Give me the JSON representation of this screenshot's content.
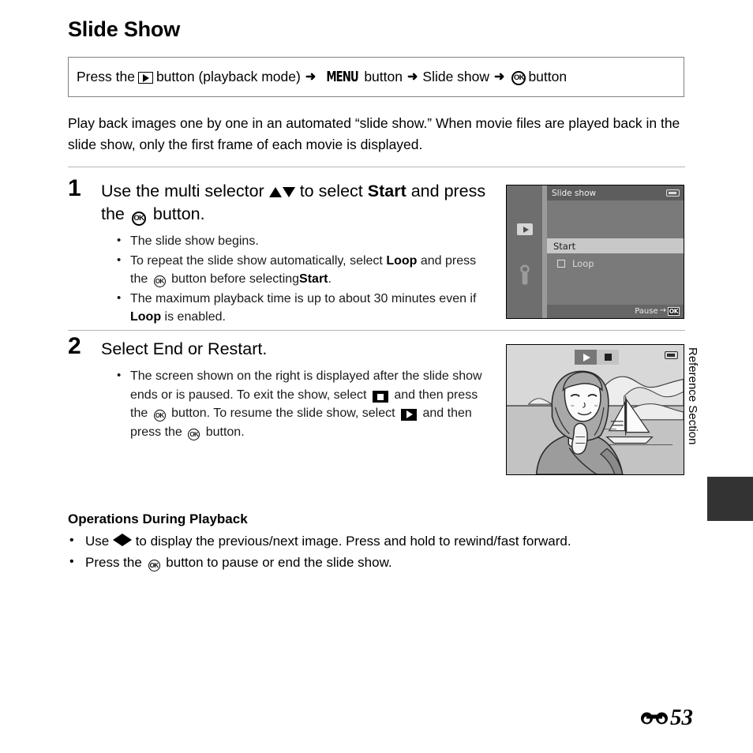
{
  "page": {
    "title": "Slide Show",
    "page_number": "53",
    "page_prefix_icon": "e-reference-symbol",
    "side_tab_label": "Reference Section"
  },
  "path_box": {
    "segments": [
      {
        "type": "text",
        "text": "Press the"
      },
      {
        "type": "icon",
        "icon": "playback-button-icon"
      },
      {
        "type": "text",
        "text": "button (playback mode)"
      },
      {
        "type": "arrow",
        "text": "➜"
      },
      {
        "type": "glyph",
        "text": "MENU"
      },
      {
        "type": "text",
        "text": "button"
      },
      {
        "type": "arrow",
        "text": "➜"
      },
      {
        "type": "text",
        "text": "Slide show"
      },
      {
        "type": "arrow",
        "text": "➜"
      },
      {
        "type": "icon",
        "icon": "ok-button-icon",
        "text": "OK"
      },
      {
        "type": "text",
        "text": "button"
      }
    ],
    "plain": "Press the (playback) button (playback mode) ➜ MENU button ➜ Slide show ➜ OK button"
  },
  "intro": "Play back images one by one in an automated “slide show.” When movie files are played back in the slide show, only the first frame of each movie is displayed.",
  "steps": [
    {
      "number": "1",
      "heading_part1": "Use the multi selector",
      "heading_part2": "to select",
      "heading_bold1": "Start",
      "heading_part3": "and press the",
      "heading_part4": "button.",
      "bullets": [
        {
          "text_a": "The slide show begins."
        },
        {
          "text_a": "To repeat the slide show automatically, select",
          "bold_a": "Loop",
          "text_b": "and press the",
          "text_c": "button before selecting",
          "bold_b": "Start",
          "text_d": "."
        },
        {
          "text_a": "The maximum playback time is up to about 30 minutes even if",
          "bold_a": "Loop",
          "text_b": "is enabled."
        }
      ]
    },
    {
      "number": "2",
      "heading": "Select End or Restart.",
      "bullets": [
        {
          "text_a": "The screen shown on the right is displayed after the slide show ends or is paused. To exit the show, select",
          "text_b": "and then press the",
          "text_c": "button. To resume the slide show, select",
          "text_d": "and then press the",
          "text_e": "button."
        }
      ]
    }
  ],
  "screen1": {
    "title": "Slide show",
    "battery_icon": "battery-icon",
    "sidebar_icons": [
      "playback-mode-icon",
      "setup-wrench-icon"
    ],
    "rows": [
      {
        "label": "Start",
        "selected": true,
        "checkbox": false
      },
      {
        "label": "Loop",
        "selected": false,
        "checkbox": true,
        "checked": false
      }
    ],
    "bottom_hint_text": "Pause",
    "bottom_hint_arrow": "→",
    "bottom_hint_button": "OK"
  },
  "screen2": {
    "controls": [
      {
        "icon": "play-icon",
        "state": "unselected"
      },
      {
        "icon": "stop-icon",
        "state": "selected"
      }
    ],
    "battery_icon": "battery-icon",
    "scene_description": "illustration-woman-sailboat-mountains"
  },
  "operations": {
    "title": "Operations During Playback",
    "items": [
      {
        "text_a": "Use",
        "icons": "left-right-arrows",
        "text_b": "to display the previous/next image. Press and hold to rewind/fast forward."
      },
      {
        "text_a": "Press the",
        "icons": "ok-button",
        "text_b": "button to pause or end the slide show."
      }
    ]
  },
  "colors": {
    "screen_bg": "#7a7a7a",
    "screen_titlebar": "#5d5d5d",
    "selected_row": "#c8c8c8",
    "side_tab": "#333333",
    "rule": "#b5b5b5"
  }
}
